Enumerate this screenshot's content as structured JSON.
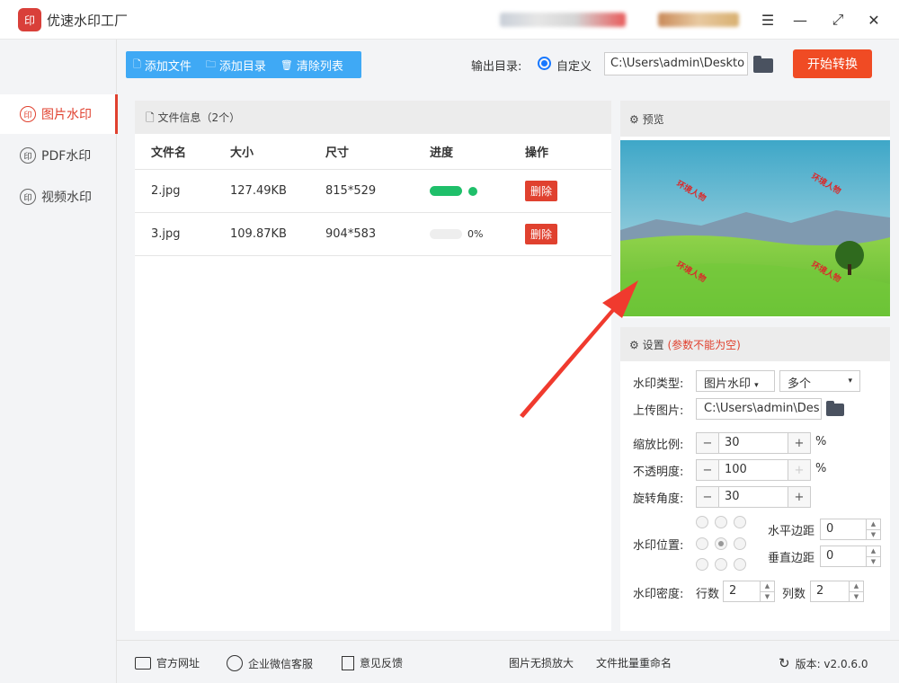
{
  "app": {
    "title": "优速水印工厂",
    "logo": "印"
  },
  "window": {
    "menu_icon": "hamburger-icon",
    "minimize": "—",
    "maximize": "⤢",
    "close": "✕"
  },
  "sidebar": {
    "items": [
      {
        "label": "图片水印",
        "icon": "印"
      },
      {
        "label": "PDF水印",
        "icon": "印"
      },
      {
        "label": "视频水印",
        "icon": "印"
      }
    ]
  },
  "toolbar": {
    "add_file": "添加文件",
    "add_dir": "添加目录",
    "clear_list": "清除列表"
  },
  "output": {
    "label": "输出目录:",
    "mode": "自定义",
    "path": "C:\\Users\\admin\\Deskto",
    "start": "开始转换"
  },
  "files": {
    "header": "文件信息（2个）",
    "columns": [
      "文件名",
      "大小",
      "尺寸",
      "进度",
      "操作"
    ],
    "rows": [
      {
        "name": "2.jpg",
        "size": "127.49KB",
        "dim": "815*529",
        "progress": 1.0,
        "pct": "",
        "action": "删除"
      },
      {
        "name": "3.jpg",
        "size": "109.87KB",
        "dim": "904*583",
        "progress": 0.0,
        "pct": "0%",
        "action": "删除"
      }
    ]
  },
  "preview": {
    "title": "预览",
    "watermark_text": "环境人物"
  },
  "settings": {
    "title": "设置",
    "note": "(参数不能为空)",
    "type_label": "水印类型:",
    "type_value": "图片水印",
    "count_value": "多个",
    "upload_label": "上传图片:",
    "upload_path": "C:\\Users\\admin\\Des",
    "scale_label": "缩放比例:",
    "scale_value": "30",
    "opacity_label": "不透明度:",
    "opacity_value": "100",
    "rotate_label": "旋转角度:",
    "rotate_value": "30",
    "pct": "%",
    "position_label": "水印位置:",
    "hmargin_label": "水平边距",
    "hmargin_value": "0",
    "vmargin_label": "垂直边距",
    "vmargin_value": "0",
    "density_label": "水印密度:",
    "rows_label": "行数",
    "rows_value": "2",
    "cols_label": "列数",
    "cols_value": "2"
  },
  "footer": {
    "website": "官方网址",
    "wechat": "企业微信客服",
    "feedback": "意见反馈",
    "upscale": "图片无损放大",
    "rename": "文件批量重命名",
    "version": "版本: v2.0.6.0"
  },
  "colors": {
    "accent": "#e0412f",
    "toolbar": "#3fa9f5",
    "start": "#f04b24",
    "progress": "#1fbf6a",
    "arrow": "#f03a2e"
  }
}
